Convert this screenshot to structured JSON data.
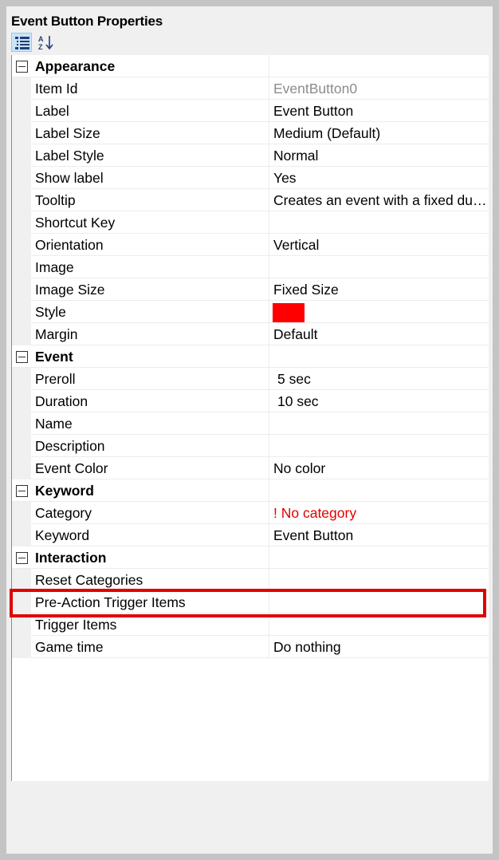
{
  "title": "Event Button Properties",
  "toolbar": {
    "categorized_icon": "categorized-view-icon",
    "alphabetical_icon": "alphabetical-sort-icon"
  },
  "colors": {
    "style_swatch": "#ff0000",
    "highlight": "#e00000"
  },
  "categories": {
    "appearance": "Appearance",
    "event": "Event",
    "keyword": "Keyword",
    "interaction": "Interaction"
  },
  "props": {
    "item_id": {
      "label": "Item Id",
      "value": "EventButton0"
    },
    "label": {
      "label": "Label",
      "value": "Event Button"
    },
    "label_size": {
      "label": "Label Size",
      "value": "Medium (Default)"
    },
    "label_style": {
      "label": "Label Style",
      "value": "Normal"
    },
    "show_label": {
      "label": "Show label",
      "value": "Yes"
    },
    "tooltip": {
      "label": "Tooltip",
      "value": "Creates an event with a fixed duration"
    },
    "shortcut_key": {
      "label": "Shortcut Key",
      "value": ""
    },
    "orientation": {
      "label": "Orientation",
      "value": "Vertical"
    },
    "image": {
      "label": "Image",
      "value": ""
    },
    "image_size": {
      "label": "Image Size",
      "value": "Fixed Size"
    },
    "style": {
      "label": "Style"
    },
    "margin": {
      "label": "Margin",
      "value": "Default"
    },
    "preroll": {
      "label": "Preroll",
      "value": "5 sec"
    },
    "duration": {
      "label": "Duration",
      "value": "10 sec"
    },
    "name": {
      "label": "Name",
      "value": ""
    },
    "description": {
      "label": "Description",
      "value": ""
    },
    "event_color": {
      "label": "Event Color",
      "value": "No color"
    },
    "category": {
      "label": "Category",
      "value": "! No category"
    },
    "keyword": {
      "label": "Keyword",
      "value": "Event Button"
    },
    "reset_categories": {
      "label": "Reset Categories",
      "value": ""
    },
    "pre_action_trigger_items": {
      "label": "Pre-Action Trigger Items",
      "value": ""
    },
    "trigger_items": {
      "label": "Trigger Items",
      "value": ""
    },
    "game_time": {
      "label": "Game time",
      "value": "Do nothing"
    }
  }
}
